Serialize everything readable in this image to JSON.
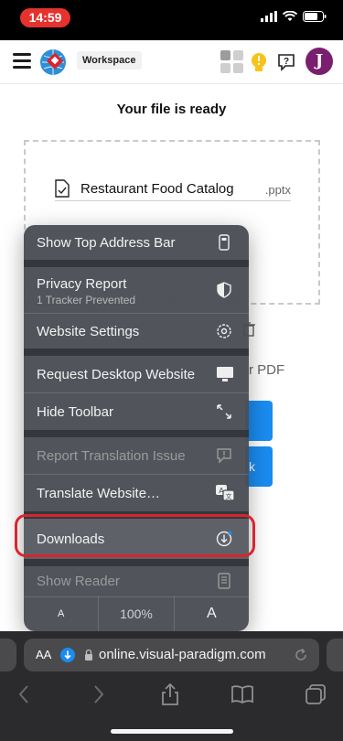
{
  "status_bar": {
    "time": "14:59"
  },
  "header": {
    "workspace_label": "Workspace",
    "avatar_initial": "J"
  },
  "page": {
    "title": "Your file is ready",
    "file_name": "Restaurant Food Catalog",
    "file_ext": ".pptx",
    "pdf_text": "r PDF",
    "button_text_2": "k"
  },
  "menu": {
    "items": [
      {
        "label": "Show Top Address Bar",
        "icon": "address-bar-icon"
      },
      {
        "label": "Privacy Report",
        "sub": "1 Tracker Prevented",
        "icon": "shield-icon"
      },
      {
        "label": "Website Settings",
        "icon": "gear-icon"
      },
      {
        "label": "Request Desktop Website",
        "icon": "monitor-icon"
      },
      {
        "label": "Hide Toolbar",
        "icon": "expand-arrows-icon"
      },
      {
        "label": "Report Translation Issue",
        "icon": "report-bubble-icon",
        "disabled": true
      },
      {
        "label": "Translate Website…",
        "icon": "translate-icon"
      },
      {
        "label": "Downloads",
        "icon": "download-circle-icon"
      },
      {
        "label": "Show Reader",
        "icon": "reader-icon",
        "disabled": true
      }
    ],
    "zoom": {
      "smaller": "A",
      "level": "100%",
      "larger": "A"
    }
  },
  "safari": {
    "aa_label": "AA",
    "url": "online.visual-paradigm.com"
  },
  "colors": {
    "highlight": "#d9252e",
    "accent_blue": "#1a8cf0",
    "avatar": "#7a1f6f",
    "time_pill": "#e5322d"
  }
}
